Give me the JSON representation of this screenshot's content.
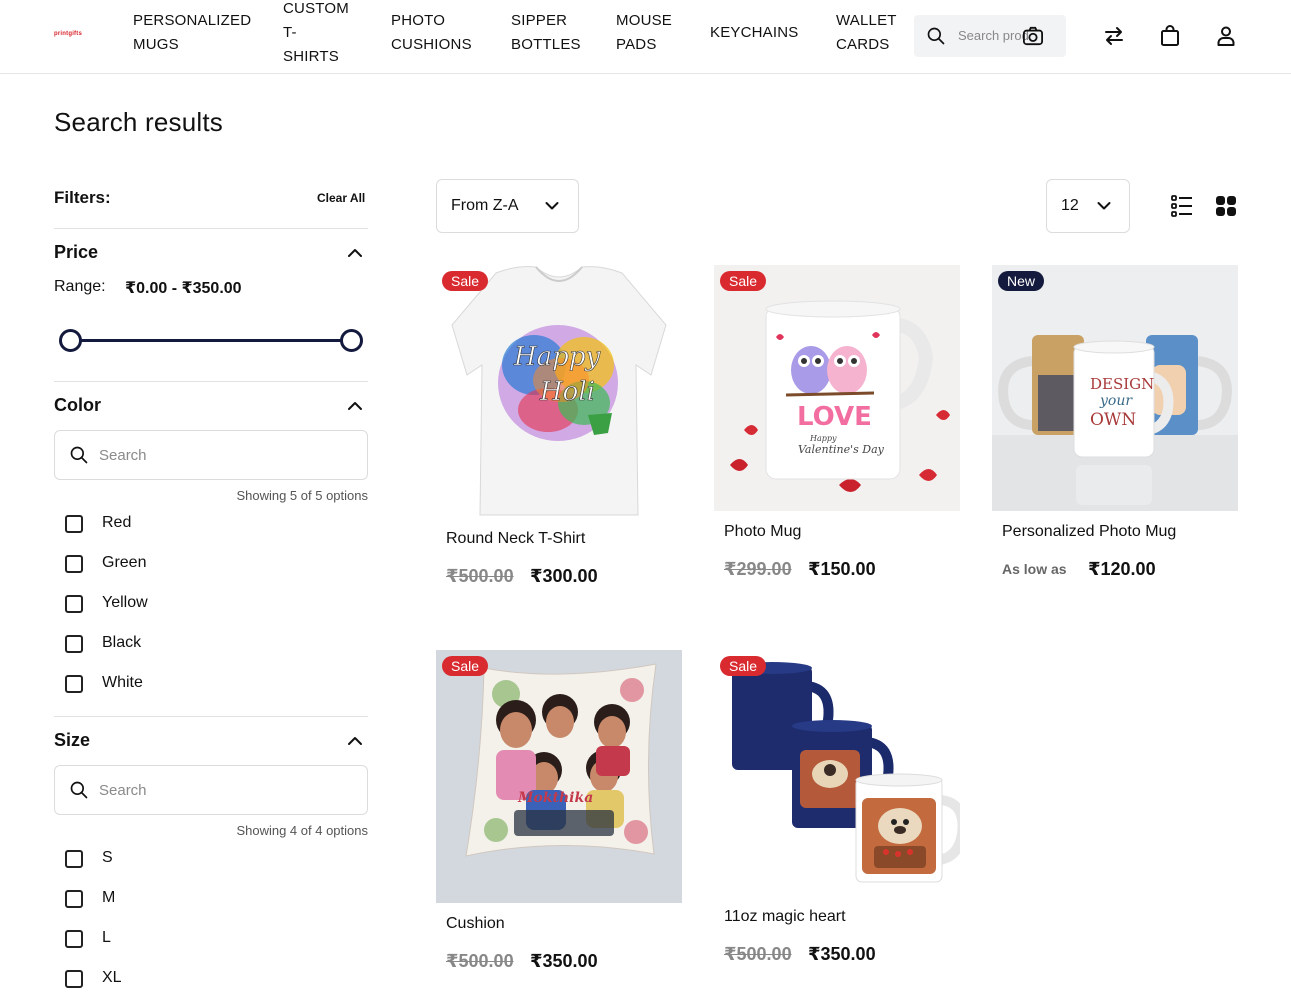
{
  "header": {
    "logo": "printgifts",
    "nav": [
      {
        "line1": "Personalized",
        "line2": "Mugs"
      },
      {
        "line1": "Custom",
        "line2": "T-",
        "line3": "Shirts"
      },
      {
        "line1": "Photo",
        "line2": "Cushions"
      },
      {
        "line1": "Sipper",
        "line2": "Bottles"
      },
      {
        "line1": "Mouse",
        "line2": "Pads"
      },
      {
        "line1": "Keychains"
      },
      {
        "line1": "Wallet",
        "line2": "Cards"
      }
    ],
    "search_placeholder": "Search products...",
    "icons": [
      "search-icon",
      "camera-icon",
      "compare-icon",
      "bag-icon",
      "user-icon"
    ]
  },
  "page_title": "Search results",
  "sidebar": {
    "filters_label": "Filters:",
    "clear_all": "Clear All",
    "price": {
      "title": "Price",
      "range_label": "Range:",
      "range_value": "₹0.00 - ₹350.00",
      "min_fraction": 0,
      "max_fraction": 1
    },
    "color": {
      "title": "Color",
      "search_placeholder": "Search",
      "showing": "Showing 5 of 5 options",
      "options": [
        "Red",
        "Green",
        "Yellow",
        "Black",
        "White"
      ]
    },
    "size": {
      "title": "Size",
      "search_placeholder": "Search",
      "showing": "Showing 4 of 4 options",
      "options": [
        "S",
        "M",
        "L",
        "XL"
      ]
    }
  },
  "toolbar": {
    "sort_value": "From Z-A",
    "limit_value": "12",
    "view_icons": [
      "list-view-icon",
      "grid-view-icon"
    ]
  },
  "products": [
    {
      "name": "Round Neck T-Shirt",
      "badge": "Sale",
      "old_price": "₹500.00",
      "price": "₹300.00"
    },
    {
      "name": "Photo Mug",
      "badge": "Sale",
      "old_price": "₹299.00",
      "price": "₹150.00"
    },
    {
      "name": "Personalized Photo Mug",
      "badge": "New",
      "low_label": "As low as",
      "price": "₹120.00"
    },
    {
      "name": "Cushion",
      "badge": "Sale",
      "old_price": "₹500.00",
      "price": "₹350.00"
    },
    {
      "name": "11oz magic heart",
      "badge": "Sale",
      "old_price": "₹500.00",
      "price": "₹350.00"
    }
  ],
  "colors": {
    "brand_red": "#d82a2f",
    "navy": "#141a3d"
  }
}
